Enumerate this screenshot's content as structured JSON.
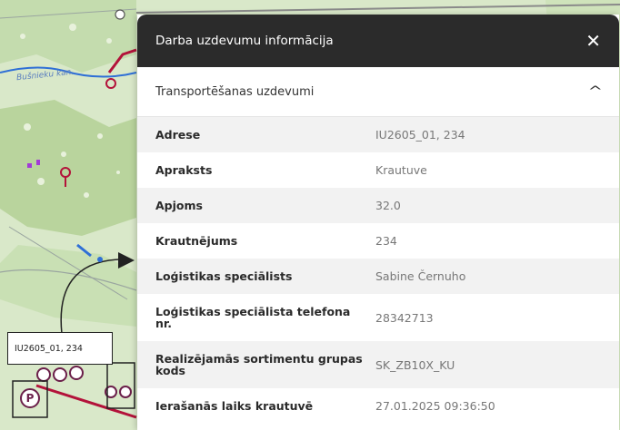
{
  "map": {
    "river_label": "Bušnieku kan.",
    "callout_label": "IU2605_01, 234",
    "parking_label": "P",
    "colors": {
      "background": "#d9e8c9",
      "forest": "#bcd6a2",
      "route": "#b3123a",
      "water": "#2f6fd6"
    }
  },
  "panel": {
    "title": "Darba uzdevumu informācija",
    "close_icon": "close-icon",
    "section": {
      "title": "Transportēšanas uzdevumi",
      "chevron_icon": "chevron-up-icon"
    },
    "rows": [
      {
        "label": "Adrese",
        "value": "IU2605_01, 234"
      },
      {
        "label": "Apraksts",
        "value": "Krautuve"
      },
      {
        "label": "Apjoms",
        "value": "32.0"
      },
      {
        "label": "Krautnējums",
        "value": "234"
      },
      {
        "label": "Loģistikas speciālists",
        "value": "Sabine Černuho"
      },
      {
        "label": "Loģistikas speciālista telefona nr.",
        "value": "28342713"
      },
      {
        "label": "Realizējamās sortimentu grupas kods",
        "value": "SK_ZB10X_KU"
      },
      {
        "label": "Ierašanās laiks krautuvē",
        "value": "27.01.2025 09:36:50"
      }
    ],
    "colors": {
      "header": "#2b2b2b",
      "row_alt": "#f2f2f2",
      "value_text": "#777777"
    }
  }
}
